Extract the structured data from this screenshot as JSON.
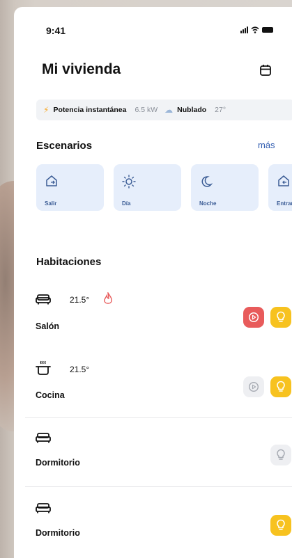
{
  "status": {
    "time": "9:41"
  },
  "header": {
    "title": "Mi vivienda"
  },
  "info_bar": {
    "power_label": "Potencia instantánea",
    "power_value": "6.5 kW",
    "weather_label": "Nublado",
    "temperature": "27°"
  },
  "scenes": {
    "title": "Escenarios",
    "more_label": "más",
    "items": [
      {
        "label": "Salir",
        "icon": "home-exit-icon"
      },
      {
        "label": "Día",
        "icon": "sun-icon"
      },
      {
        "label": "Noche",
        "icon": "moon-icon"
      },
      {
        "label": "Entrar",
        "icon": "home-enter-icon"
      }
    ]
  },
  "rooms": {
    "title": "Habitaciones",
    "items": [
      {
        "name": "Salón",
        "icon": "sofa-icon",
        "temperature": "21.5°",
        "heating": true,
        "media_active": true,
        "light_on": true
      },
      {
        "name": "Cocina",
        "icon": "pot-icon",
        "temperature": "21.5°",
        "heating": false,
        "media_active": false,
        "light_on": true
      },
      {
        "name": "Dormitorio",
        "icon": "bed-icon",
        "temperature": "",
        "heating": false,
        "light_on": false
      },
      {
        "name": "Dormitorio",
        "icon": "bed-icon",
        "temperature": "",
        "heating": false,
        "light_on": true
      }
    ]
  },
  "colors": {
    "accent_blue": "#2f5bb0",
    "scene_bg": "#e6eefb",
    "red": "#e85b5b",
    "yellow": "#f7c21f"
  }
}
